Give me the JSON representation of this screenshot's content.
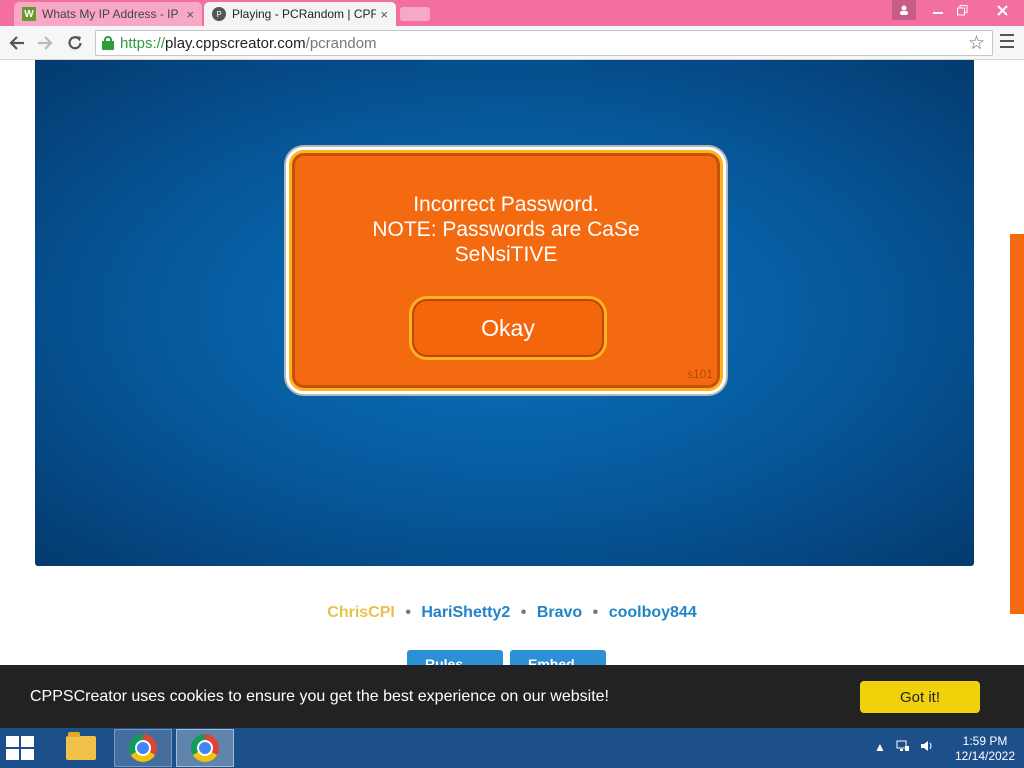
{
  "browser": {
    "tabs": [
      {
        "label": "Whats My IP Address - IP",
        "favicon": "W",
        "close": "×"
      },
      {
        "label": "Playing - PCRandom | CPF",
        "favicon": "P",
        "close": "×"
      }
    ],
    "url": {
      "scheme": "https://",
      "host": "play.cppscreator.com",
      "path": "/pcrandom"
    },
    "accent_color": "#f26fa0"
  },
  "game": {
    "dialog": {
      "lines": [
        "Incorrect Password.",
        "NOTE: Passwords are CaSe",
        "SeNsiTIVE"
      ],
      "button_label": "Okay",
      "code": "s101"
    }
  },
  "credits": [
    "ChrisCPI",
    "HariShetty2",
    "Bravo",
    "coolboy844"
  ],
  "credit_separator": "•",
  "page_buttons": [
    "Rules",
    "Embed"
  ],
  "cookie_bar": {
    "message": "CPPSCreator uses cookies to ensure you get the best experience on our website!",
    "button_label": "Got it!"
  },
  "taskbar": {
    "time": "1:59 PM",
    "date": "12/14/2022"
  }
}
